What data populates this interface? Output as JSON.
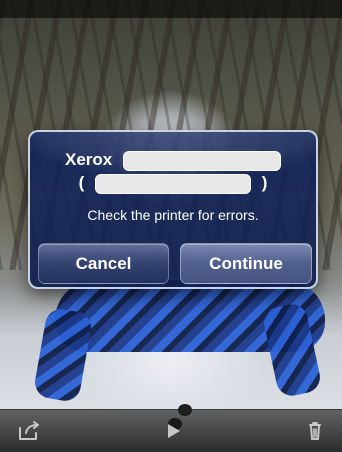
{
  "alert": {
    "title_prefix": "Xerox",
    "title_open_paren": "(",
    "title_close_paren": ")",
    "message": "Check the printer for errors.",
    "buttons": {
      "cancel_label": "Cancel",
      "continue_label": "Continue"
    }
  },
  "toolbar": {
    "icons": [
      "share-icon",
      "play-icon",
      "trash-icon"
    ]
  }
}
